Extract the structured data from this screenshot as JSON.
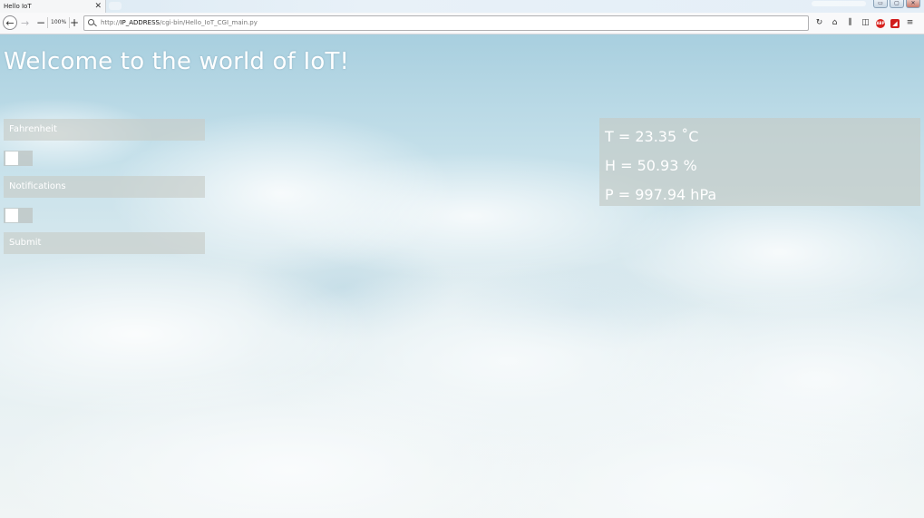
{
  "browser": {
    "tab_title": "Hello IoT",
    "tab_close": "✕",
    "zoom_out": "−",
    "zoom_level": "100%",
    "zoom_in": "+",
    "url_prefix": "http://",
    "url_host": "IP_ADDRESS",
    "url_path": "/cgi-bin/Hello_IoT_CGI_main.py",
    "window_controls": [
      "▭",
      "▢",
      "✕"
    ],
    "toolbar_icons": [
      "reload-icon",
      "home-icon",
      "library-icon",
      "sidebar-icon",
      "adblock-icon",
      "extension-icon",
      "menu-icon"
    ]
  },
  "page": {
    "title": "Welcome to the world of IoT!",
    "form": {
      "fahrenheit_label": "Fahrenheit",
      "fahrenheit_on": false,
      "notifications_label": "Notifications",
      "notifications_on": false,
      "submit_label": "Submit"
    },
    "readings": {
      "temperature": "T = 23.35 ˚C",
      "humidity": "H = 50.93 %",
      "pressure": "P = 997.94 hPa"
    }
  },
  "colors": {
    "sky_top": "#a8cfdf",
    "panel": "#c4ccc8",
    "text": "#ffffff"
  }
}
